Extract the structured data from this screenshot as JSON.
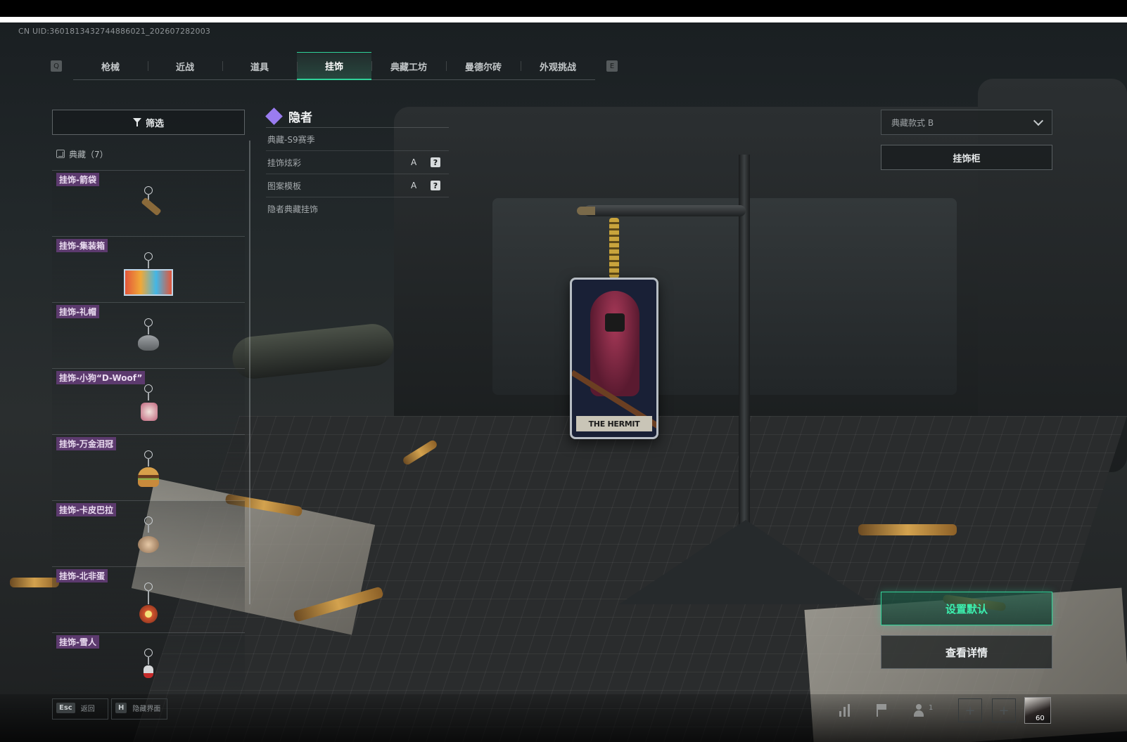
{
  "uid": "CN UID:3601813432744886021_202607282003",
  "tab_bar": {
    "prev_key": "Q",
    "next_key": "E",
    "tabs": [
      {
        "label": "枪械",
        "active": false
      },
      {
        "label": "近战",
        "active": false
      },
      {
        "label": "道具",
        "active": false
      },
      {
        "label": "挂饰",
        "active": true
      },
      {
        "label": "典藏工坊",
        "active": false
      },
      {
        "label": "曼德尔砖",
        "active": false
      },
      {
        "label": "外观挑战",
        "active": false
      }
    ]
  },
  "left_panel": {
    "filter_label": "筛选",
    "category_label": "典藏（7）",
    "items": [
      {
        "tag": "挂饰-箭袋",
        "icon": "quiver-charm"
      },
      {
        "tag": "挂饰-集装箱",
        "icon": "container-charm"
      },
      {
        "tag": "挂饰-礼帽",
        "icon": "top-hat-charm"
      },
      {
        "tag": "挂饰-小狗“D-Woof”",
        "icon": "puppy-charm"
      },
      {
        "tag": "挂饰-万金泪冠",
        "icon": "burger-charm"
      },
      {
        "tag": "挂饰-卡皮巴拉",
        "icon": "capybara-charm"
      },
      {
        "tag": "挂饰-北非蛋",
        "icon": "shakshuka-charm"
      },
      {
        "tag": "挂饰-雪人",
        "icon": "snowman-charm"
      }
    ]
  },
  "info_panel": {
    "title": "隐者",
    "rows": [
      {
        "label": "典藏-S9赛季"
      },
      {
        "label": "挂饰炫彩",
        "grade": "A",
        "help": "?"
      },
      {
        "label": "图案模板",
        "grade": "A",
        "help": "?"
      },
      {
        "label": "隐者典藏挂饰"
      }
    ]
  },
  "right_panel": {
    "style_select_value": "典藏款式 B",
    "charm_cabinet_label": "挂饰柜",
    "set_default_label": "设置默认",
    "view_details_label": "查看详情"
  },
  "charm_card": {
    "banner_text": "THE HERMIT"
  },
  "bottom_bar": {
    "esc_key": "Esc",
    "esc_label": "返回",
    "hide_key": "H",
    "hide_label": "隐藏界面",
    "friends_count": "1",
    "avatar_level": "60"
  },
  "colors": {
    "accent_green": "#2fd39a",
    "tag_purple": "#5c3a6e",
    "diamond_purple": "#9a7cf0"
  }
}
